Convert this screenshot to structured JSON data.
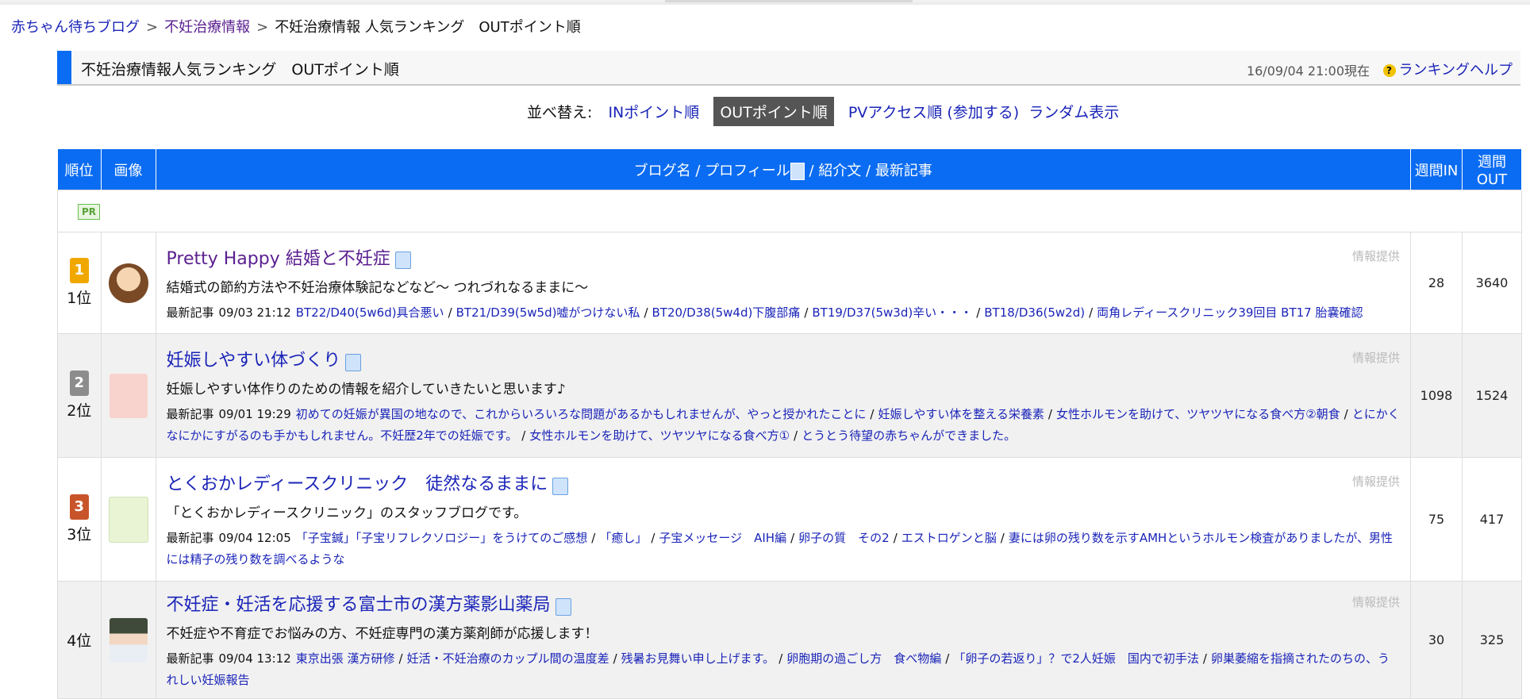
{
  "breadcrumb": {
    "home": "赤ちゃん待ちブログ",
    "category": "不妊治療情報",
    "current": "不妊治療情報 人気ランキング　OUTポイント順"
  },
  "title_bar": {
    "title": "不妊治療情報人気ランキング　OUTポイント順",
    "updated": "16/09/04 21:00現在",
    "help": "ランキングヘルプ"
  },
  "sort": {
    "label": "並べ替え:",
    "in_points": "INポイント順",
    "out_points": "OUTポイント順",
    "pv_access": "PVアクセス順",
    "join": "(参加する)",
    "random": "ランダム表示"
  },
  "table_headers": {
    "rank": "順位",
    "image": "画像",
    "blog_prefix": "ブログ名 / プロフィール",
    "blog_suffix": " / 紹介文 / 最新記事",
    "weekly_in": "週間IN",
    "weekly_out": "週間OUT"
  },
  "pr_label": "PR",
  "colors": {
    "accent_blue": "#0a6cf2",
    "link_blue": "#1a24b8",
    "gold": "#f0a800",
    "silver": "#8c8c8c",
    "bronze": "#c8552a"
  },
  "rows": [
    {
      "rank_label": "1位",
      "badge": "1",
      "blog_name": "Pretty Happy 結婚と不妊症",
      "intro": "結婚式の節約方法や不妊治療体験記などなど〜 つれづれなるままに〜",
      "provider": "情報提供",
      "recent_label": "最新記事",
      "recent_date": "09/03 21:12",
      "articles": [
        "BT22/D40(5w6d)具合悪い",
        "BT21/D39(5w5d)嘘がつけない私",
        "BT20/D38(5w4d)下腹部痛",
        "BT19/D37(5w3d)辛い・・・",
        "BT18/D36(5w2d)",
        "両角レディースクリニック39回目 BT17 胎嚢確認"
      ],
      "weekly_in": "28",
      "weekly_out": "3640"
    },
    {
      "rank_label": "2位",
      "badge": "2",
      "blog_name": "妊娠しやすい体づくり",
      "intro": "妊娠しやすい体作りのための情報を紹介していきたいと思います♪",
      "provider": "情報提供",
      "recent_label": "最新記事",
      "recent_date": "09/01 19:29",
      "articles": [
        "初めての妊娠が異国の地なので、これからいろいろな問題があるかもしれませんが、やっと授かれたことに",
        "妊娠しやすい体を整える栄養素",
        "女性ホルモンを助けて、ツヤツヤになる食べ方②朝食",
        "とにかくなにかにすがるのも手かもしれません。不妊歴2年での妊娠です。",
        "女性ホルモンを助けて、ツヤツヤになる食べ方①",
        "とうとう待望の赤ちゃんができました。"
      ],
      "weekly_in": "1098",
      "weekly_out": "1524"
    },
    {
      "rank_label": "3位",
      "badge": "3",
      "blog_name": "とくおかレディースクリニック　徒然なるままに",
      "intro": "「とくおかレディースクリニック」のスタッフブログです。",
      "provider": "情報提供",
      "recent_label": "最新記事",
      "recent_date": "09/04 12:05",
      "articles": [
        "「子宝鍼」「子宝リフレクソロジー」をうけてのご感想",
        "「癒し」",
        "子宝メッセージ　AIH編",
        "卵子の質　その2",
        "エストロゲンと脳",
        "妻には卵の残り数を示すAMHというホルモン検査がありましたが、男性には精子の残り数を調べるような"
      ],
      "weekly_in": "75",
      "weekly_out": "417"
    },
    {
      "rank_label": "4位",
      "badge": "",
      "blog_name": "不妊症・妊活を応援する富士市の漢方薬影山薬局",
      "intro": "不妊症や不育症でお悩みの方、不妊症専門の漢方薬剤師が応援します！",
      "provider": "情報提供",
      "recent_label": "最新記事",
      "recent_date": "09/04 13:12",
      "articles": [
        "東京出張 漢方研修",
        "妊活・不妊治療のカップル間の温度差",
        "残暑お見舞い申し上げます。",
        "卵胞期の過ごし方　食べ物編",
        "「卵子の若返り」？で2人妊娠　国内で初手法",
        "卵巣萎縮を指摘されたのちの、うれしい妊娠報告"
      ],
      "weekly_in": "30",
      "weekly_out": "325"
    }
  ]
}
